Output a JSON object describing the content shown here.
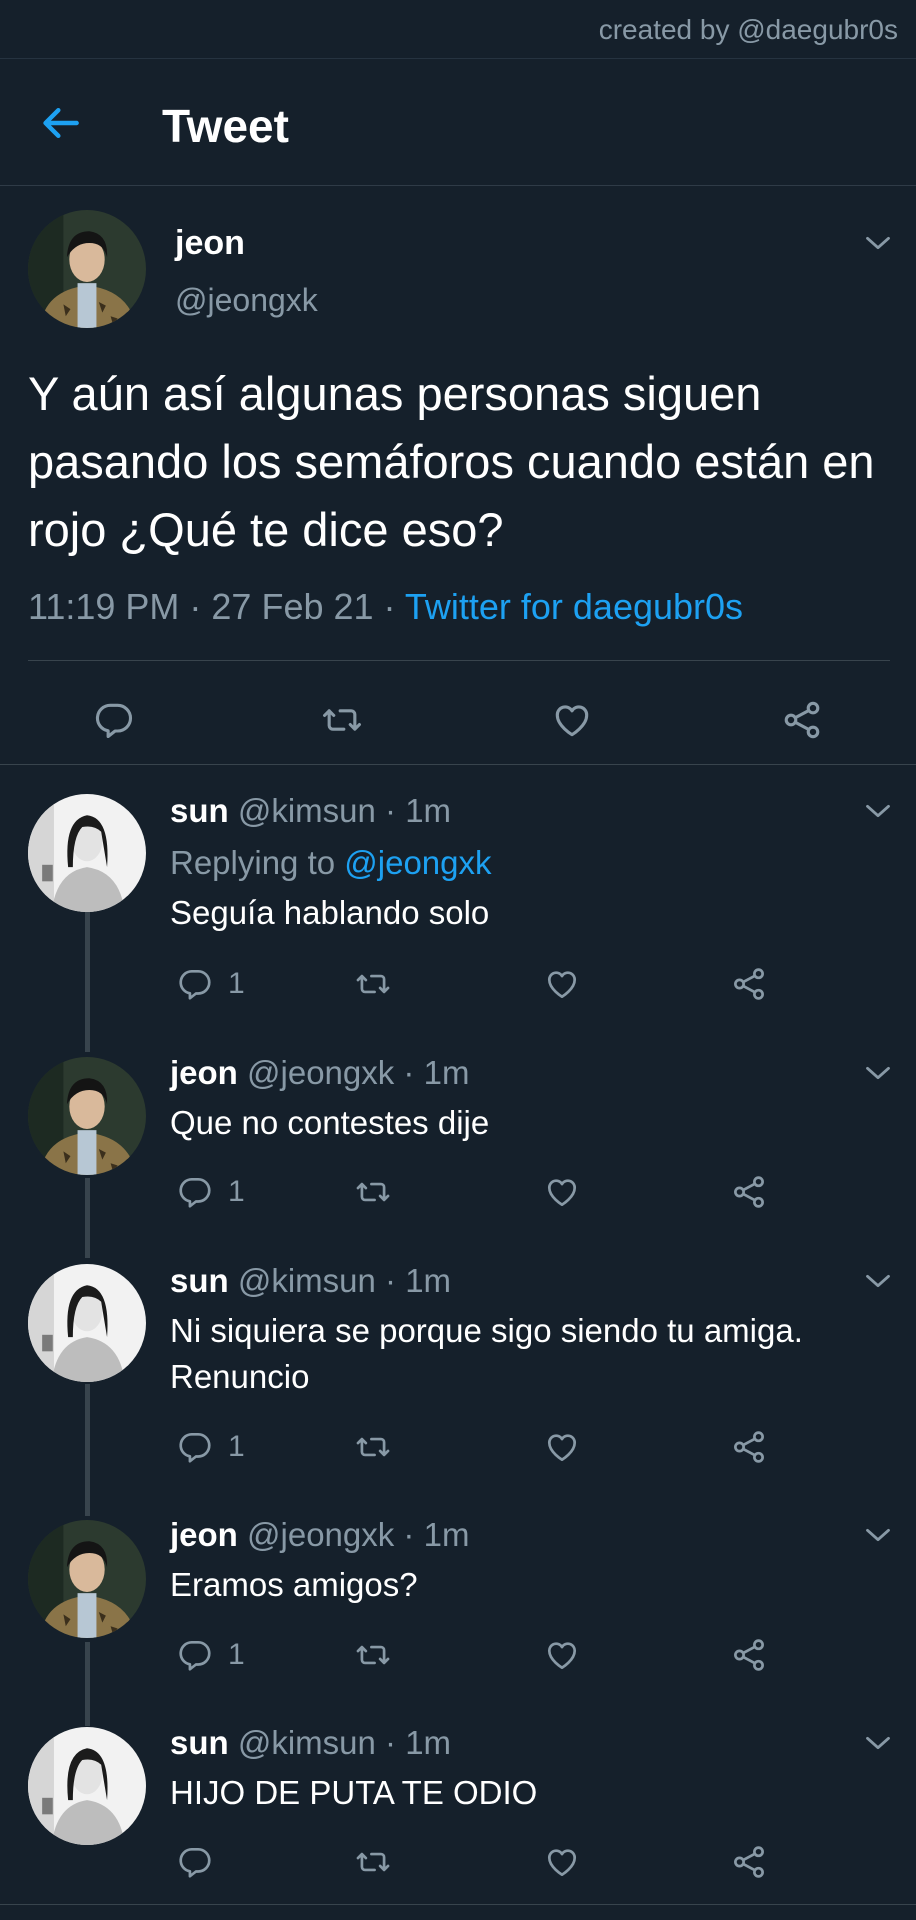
{
  "watermark": "created by @daegubr0s",
  "header": {
    "title": "Tweet",
    "back_icon": "arrow-left-icon"
  },
  "colors": {
    "background": "#15202b",
    "accent": "#1da1f2",
    "muted": "#8899a6",
    "divider": "#38444d"
  },
  "tweet": {
    "name": "jeon",
    "handle": "@jeongxk",
    "text": "Y aún así algunas personas siguen pasando los semáforos cuando están en rojo ¿Qué te dice eso?",
    "time": "11:19 PM · 27 Feb 21 · ",
    "source": "Twitter for daegubr0s",
    "actions": [
      "reply-icon",
      "retweet-icon",
      "like-icon",
      "share-icon"
    ]
  },
  "replies": [
    {
      "name": "sun",
      "handle": "@kimsun · 1m",
      "replying_prefix": "Replying to ",
      "replying_to": "@jeongxk",
      "text": "Seguía hablando solo",
      "reply_count": "1"
    },
    {
      "name": "jeon",
      "handle": "@jeongxk · 1m",
      "text": "Que no contestes dije",
      "reply_count": "1"
    },
    {
      "name": "sun",
      "handle": "@kimsun · 1m",
      "text": "Ni siquiera se porque sigo siendo tu amiga. Renuncio",
      "reply_count": "1"
    },
    {
      "name": "jeon",
      "handle": "@jeongxk · 1m",
      "text": "Eramos amigos?",
      "reply_count": "1"
    },
    {
      "name": "sun",
      "handle": "@kimsun · 1m",
      "text": "HIJO DE PUTA TE ODIO",
      "reply_count": ""
    }
  ]
}
